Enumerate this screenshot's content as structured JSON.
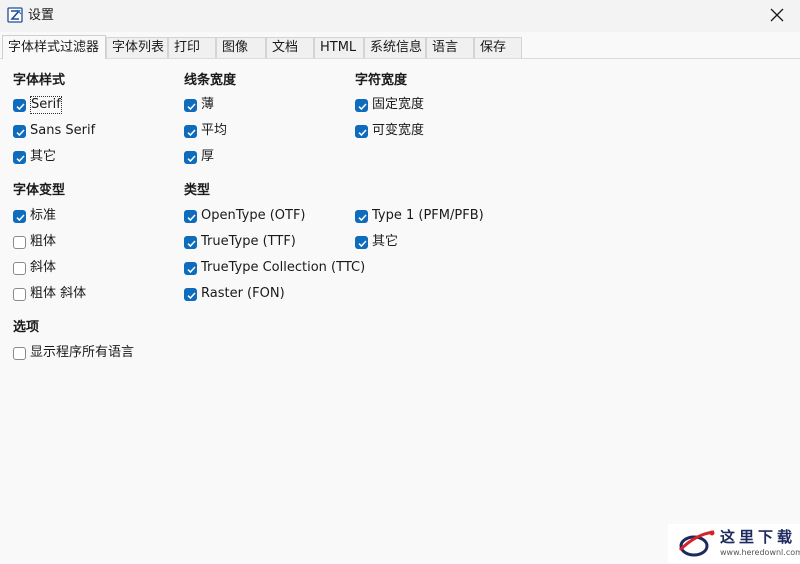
{
  "window": {
    "title": "设置",
    "icon": "settings-app-icon",
    "close_icon": "close-icon"
  },
  "tabs": [
    {
      "label": "字体样式过滤器",
      "active": true
    },
    {
      "label": "字体列表",
      "active": false
    },
    {
      "label": "打印",
      "active": false
    },
    {
      "label": "图像",
      "active": false
    },
    {
      "label": "文档",
      "active": false
    },
    {
      "label": "HTML",
      "active": false
    },
    {
      "label": "系统信息",
      "active": false
    },
    {
      "label": "语言",
      "active": false
    },
    {
      "label": "保存",
      "active": false
    }
  ],
  "groups": {
    "font_style": {
      "title": "字体样式",
      "options": [
        {
          "label": "Serif",
          "checked": true
        },
        {
          "label": "Sans Serif",
          "checked": true
        },
        {
          "label": "其它",
          "checked": true
        }
      ]
    },
    "line_width": {
      "title": "线条宽度",
      "options": [
        {
          "label": "薄",
          "checked": true
        },
        {
          "label": "平均",
          "checked": true
        },
        {
          "label": "厚",
          "checked": true
        }
      ]
    },
    "char_width": {
      "title": "字符宽度",
      "options": [
        {
          "label": "固定宽度",
          "checked": true
        },
        {
          "label": "可变宽度",
          "checked": true
        }
      ]
    },
    "font_variant": {
      "title": "字体变型",
      "options": [
        {
          "label": "标准",
          "checked": true
        },
        {
          "label": "粗体",
          "checked": false
        },
        {
          "label": "斜体",
          "checked": false
        },
        {
          "label": "粗体 斜体",
          "checked": false
        }
      ]
    },
    "type": {
      "title": "类型",
      "options": [
        {
          "label": "OpenType (OTF)",
          "checked": true
        },
        {
          "label": "TrueType (TTF)",
          "checked": true
        },
        {
          "label": "TrueType Collection (TTC)",
          "checked": true
        },
        {
          "label": "Raster (FON)",
          "checked": true
        },
        {
          "label": "Type 1 (PFM/PFB)",
          "checked": true
        },
        {
          "label": "其它",
          "checked": true
        }
      ]
    },
    "options": {
      "title": "选项",
      "options": [
        {
          "label": "显示程序所有语言",
          "checked": false
        }
      ]
    }
  },
  "watermark": {
    "text": "这里下载",
    "url": "www.heredownl.com"
  },
  "colors": {
    "accent": "#0f6cbd",
    "background": "#f9f9f9",
    "titlebar": "#f3f3f3"
  }
}
